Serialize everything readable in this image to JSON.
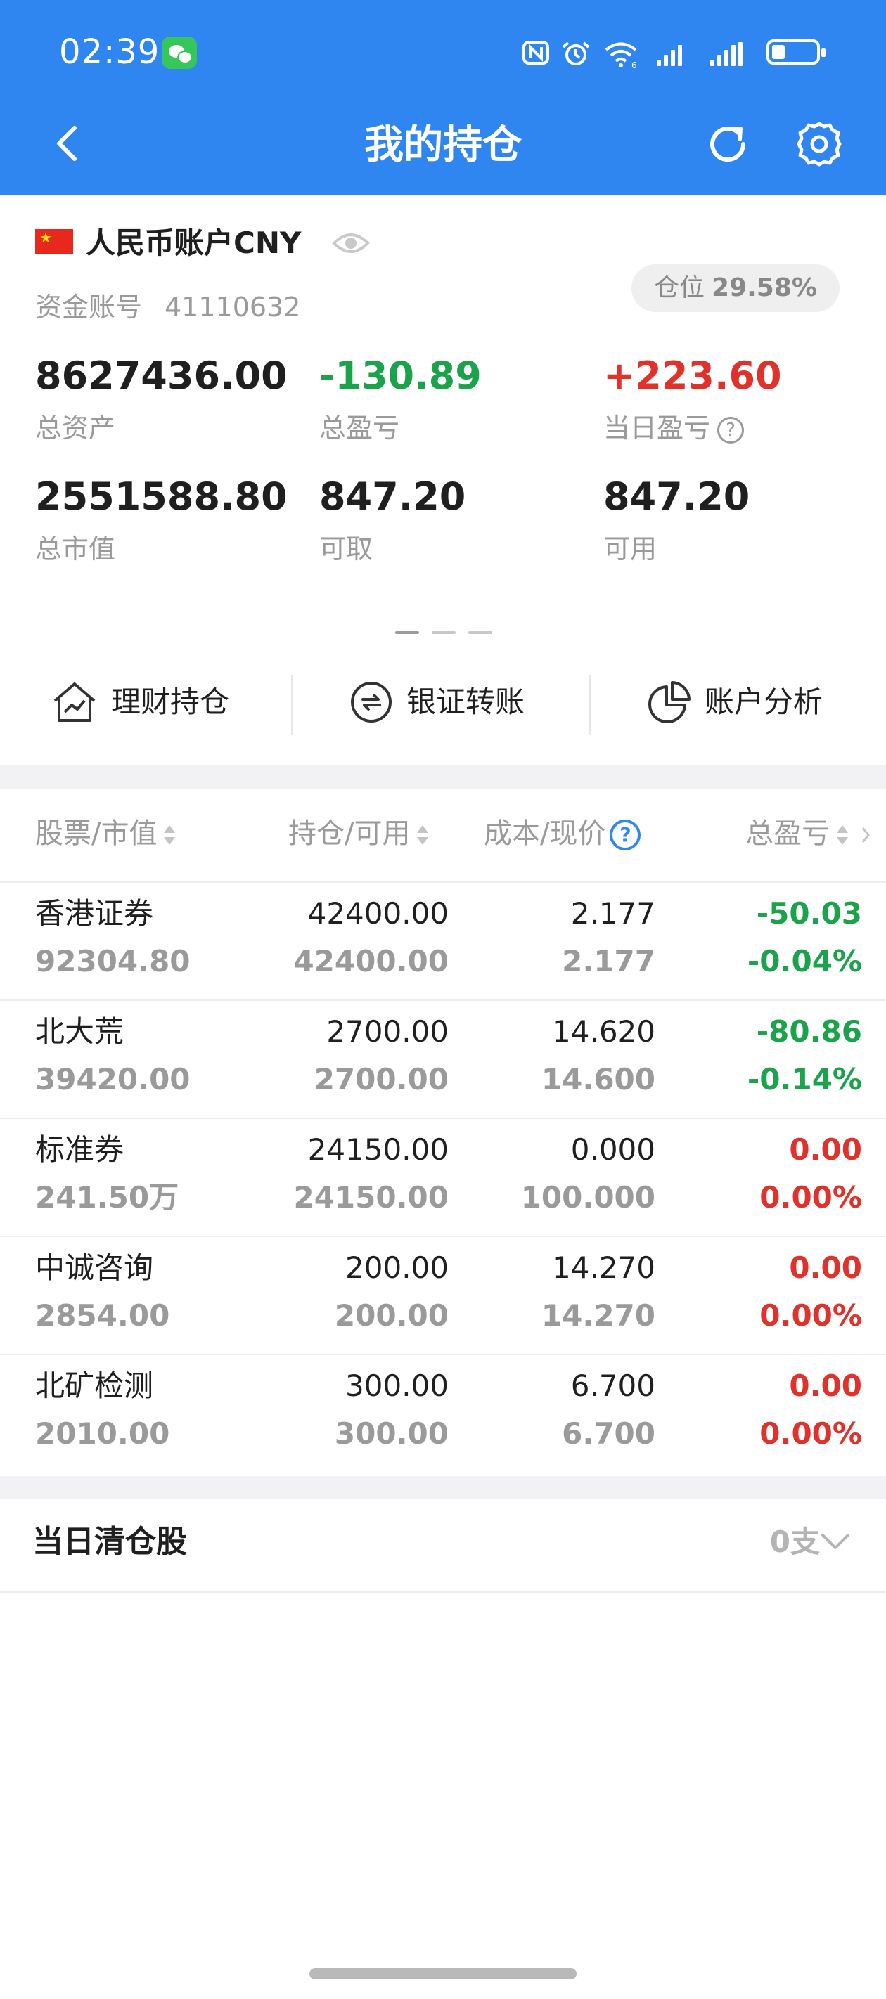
{
  "status_bar": {
    "time": "02:39",
    "battery_level_pct": 30
  },
  "header": {
    "title": "我的持仓"
  },
  "account": {
    "name": "人民币账户CNY",
    "fund_account_label": "资金账号",
    "fund_account_no": "41110632",
    "position_label": "仓位",
    "position_value": "29.58%"
  },
  "metrics": [
    {
      "value": "8627436.00",
      "label": "总资产",
      "color": "#1f1f1f"
    },
    {
      "value": "-130.89",
      "label": "总盈亏",
      "color": "#1aa34a"
    },
    {
      "value": "+223.60",
      "label": "当日盈亏",
      "color": "#e0322b"
    },
    {
      "value": "2551588.80",
      "label": "总市值",
      "color": "#1f1f1f"
    },
    {
      "value": "847.20",
      "label": "可取",
      "color": "#1f1f1f"
    },
    {
      "value": "847.20",
      "label": "可用",
      "color": "#1f1f1f"
    }
  ],
  "quick_actions": [
    {
      "label": "理财持仓",
      "icon": "house-chart-icon"
    },
    {
      "label": "银证转账",
      "icon": "transfer-icon"
    },
    {
      "label": "账户分析",
      "icon": "pie-chart-icon"
    }
  ],
  "table": {
    "headers": [
      "股票/市值",
      "持仓/可用",
      "成本/现价",
      "总盈亏"
    ],
    "rows": [
      {
        "name": "香港证券",
        "market_value": "92304.80",
        "holding": "42400.00",
        "available": "42400.00",
        "cost": "2.177",
        "price": "2.177",
        "pl": "-50.03",
        "pl_pct": "-0.04%",
        "color": "#1aa34a"
      },
      {
        "name": "北大荒",
        "market_value": "39420.00",
        "holding": "2700.00",
        "available": "2700.00",
        "cost": "14.620",
        "price": "14.600",
        "pl": "-80.86",
        "pl_pct": "-0.14%",
        "color": "#1aa34a"
      },
      {
        "name": "标准券",
        "market_value": "241.50万",
        "holding": "24150.00",
        "available": "24150.00",
        "cost": "0.000",
        "price": "100.000",
        "pl": "0.00",
        "pl_pct": "0.00%",
        "color": "#e0322b"
      },
      {
        "name": "中诚咨询",
        "market_value": "2854.00",
        "holding": "200.00",
        "available": "200.00",
        "cost": "14.270",
        "price": "14.270",
        "pl": "0.00",
        "pl_pct": "0.00%",
        "color": "#e0322b"
      },
      {
        "name": "北矿检测",
        "market_value": "2010.00",
        "holding": "300.00",
        "available": "300.00",
        "cost": "6.700",
        "price": "6.700",
        "pl": "0.00",
        "pl_pct": "0.00%",
        "color": "#e0322b"
      }
    ]
  },
  "cleared_today": {
    "title": "当日清仓股",
    "count": "0支"
  }
}
